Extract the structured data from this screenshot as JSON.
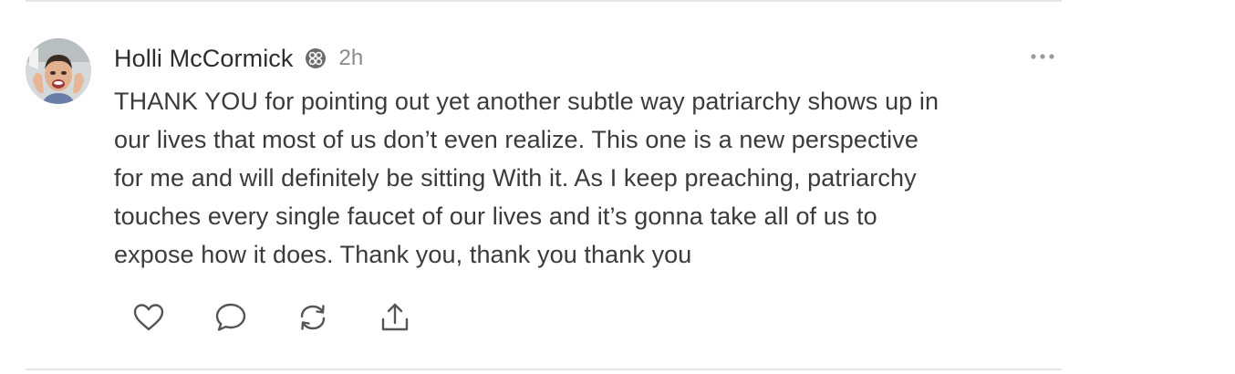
{
  "post": {
    "author": "Holli McCormick",
    "time": "2h",
    "body_lines": [
      "THANK YOU for pointing out yet another subtle way patriarchy shows up in",
      "our lives that most of us don’t even realize. This one is a new perspective",
      "for me and will definitely be sitting With it. As I keep preaching, patriarchy",
      "touches every single faucet of our lives and it’s gonna take all of us to",
      "expose how it does. Thank you, thank you thank you"
    ]
  },
  "icons": {
    "avatar": "avatar-photo",
    "badge": "verified-badge-icon",
    "more": "more-dots-icon",
    "actions": [
      "heart-icon",
      "comment-icon",
      "repost-icon",
      "share-icon"
    ]
  },
  "colors": {
    "text": "#3b3b3b",
    "muted": "#8a8a8a",
    "divider": "#e6e6e6",
    "icon": "#555555"
  }
}
